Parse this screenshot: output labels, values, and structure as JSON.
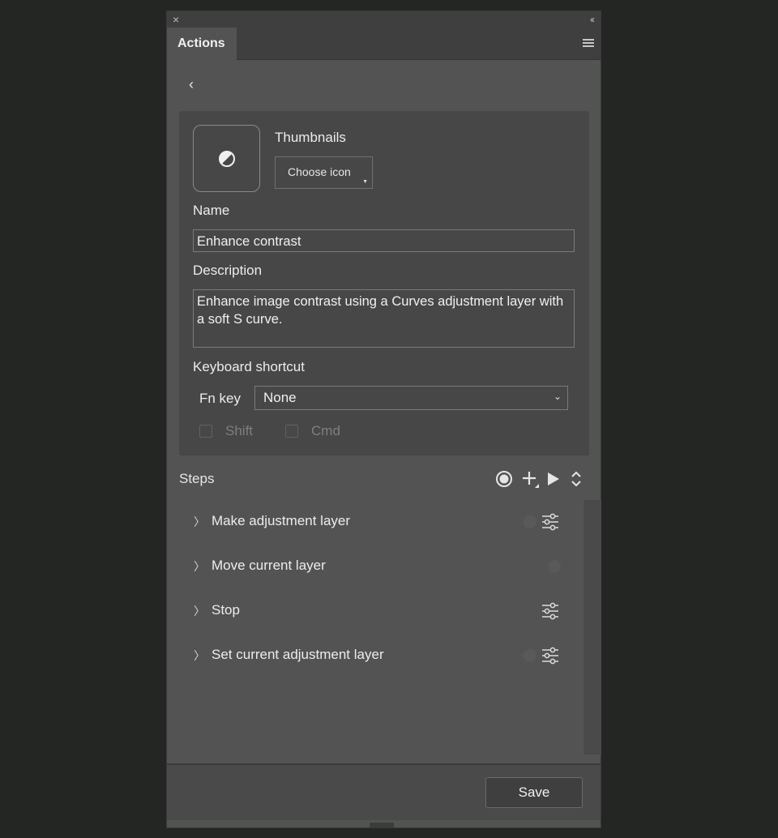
{
  "window": {
    "close_glyph": "×",
    "collapse_glyph": "‹‹",
    "tab_label": "Actions"
  },
  "editor": {
    "back_glyph": "‹",
    "thumbnails_label": "Thumbnails",
    "choose_icon_label": "Choose icon",
    "name_label": "Name",
    "name_value": "Enhance contrast",
    "description_label": "Description",
    "description_value": "Enhance image contrast using a Curves adjustment layer with a soft S curve.",
    "shortcut_label": "Keyboard shortcut",
    "fn_key_label": "Fn key",
    "fn_key_value": "None",
    "shift_label": "Shift",
    "cmd_label": "Cmd"
  },
  "steps": {
    "title": "Steps",
    "items": [
      {
        "label": "Make adjustment layer"
      },
      {
        "label": "Move current layer"
      },
      {
        "label": "Stop"
      },
      {
        "label": "Set current adjustment layer"
      }
    ]
  },
  "footer": {
    "save_label": "Save"
  },
  "icons": {
    "close": "close-icon",
    "collapse": "collapse-icon",
    "menu": "hamburger-menu-icon",
    "thumbnail": "contrast-icon",
    "record": "record-icon",
    "add": "add-step-icon",
    "play": "play-icon",
    "reorder": "expand-collapse-icon",
    "settings": "sliders-icon"
  },
  "colors": {
    "panel_bg": "#535353",
    "card_bg": "#474747",
    "app_bg": "#242624"
  }
}
